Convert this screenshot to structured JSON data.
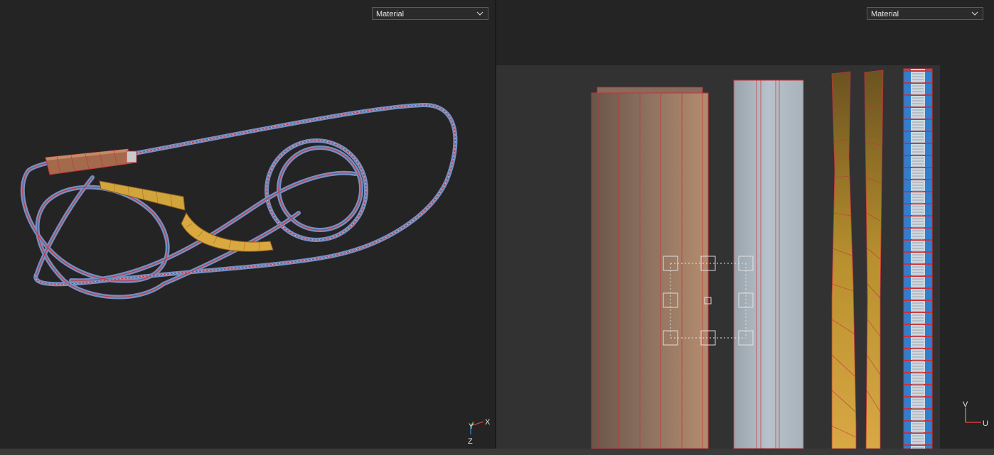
{
  "viewport_left": {
    "shading_mode": "Material",
    "axis_labels": {
      "x": "X",
      "y": "Y",
      "z": "Z"
    }
  },
  "viewport_right": {
    "shading_mode": "Material",
    "axis_labels": {
      "v": "V",
      "u": "U"
    }
  },
  "icons": [
    "chevron-down-icon",
    "axis-gizmo-icon",
    "uv-axis-gizmo-icon",
    "transform-gizmo-icon"
  ],
  "colors": {
    "viewport_bg": "#242424",
    "uv_canvas_bg": "#323232",
    "seam_red": "#c8323c",
    "tube_blue": "#7d9ad2",
    "yellow_material": "#d2a53c",
    "wood_material": "#b48c6e",
    "metal_material": "#b4bec8"
  }
}
